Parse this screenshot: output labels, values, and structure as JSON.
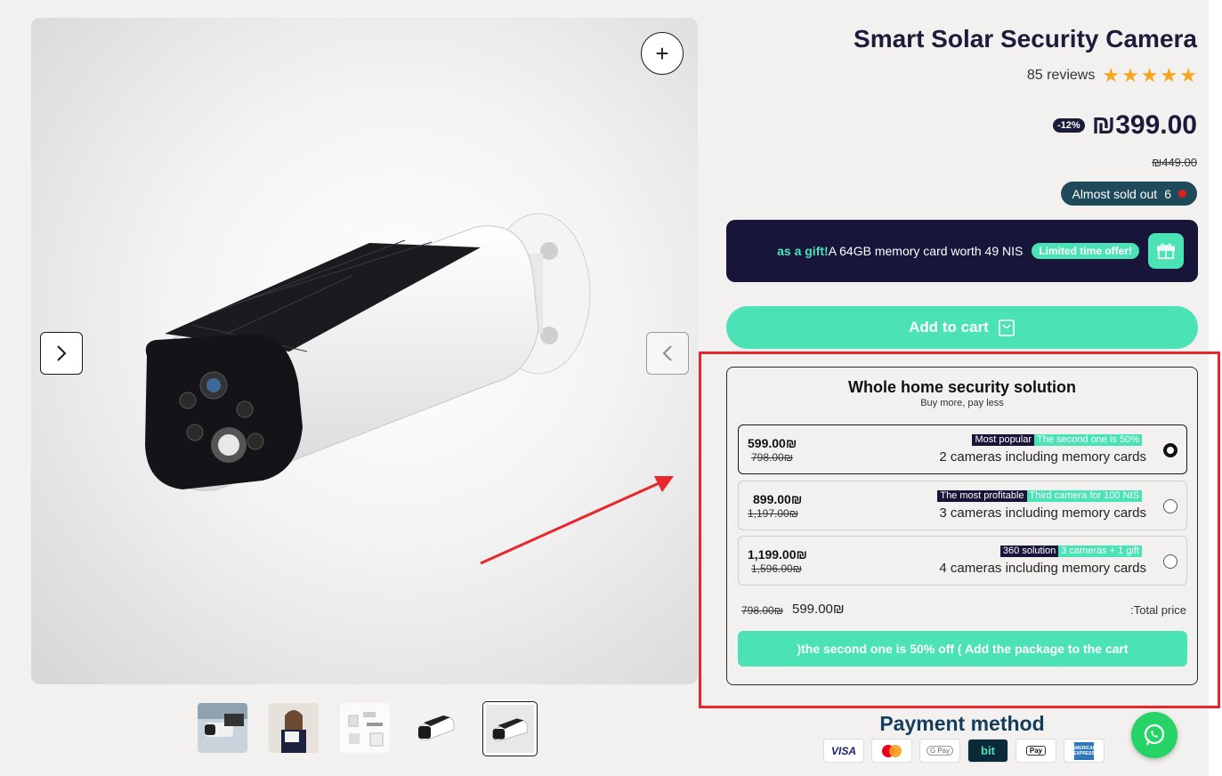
{
  "product": {
    "title": "Smart Solar Security Camera",
    "reviews_text": "85 reviews",
    "rating": 5,
    "discount_badge": "-12%",
    "price": "₪399.00",
    "old_price": "₪449.00",
    "stock_text": "Almost sold out",
    "stock_count": "6"
  },
  "gift_banner": {
    "highlight": "as a gift!",
    "text": "A 64GB memory card worth 49 NIS",
    "pill": "Limited time offer!",
    "icon": "gift-icon"
  },
  "add_to_cart": {
    "label": "Add to cart",
    "icon": "shopping-bag-icon"
  },
  "bundle": {
    "title": "Whole home security solution",
    "subtitle": "Buy more, pay less",
    "options": [
      {
        "price": "599.00₪",
        "old_price": "798.00₪",
        "tag_dark": "Most popular",
        "tag_green": "The second one is 50%",
        "description": "2 cameras including memory cards",
        "selected": true
      },
      {
        "price": "899.00₪",
        "old_price": "1,197.00₪",
        "tag_dark": "The most profitable",
        "tag_green": "Third camera for 100 NIS",
        "description": "3 cameras including memory cards",
        "selected": false
      },
      {
        "price": "1,199.00₪",
        "old_price": "1,596.00₪",
        "tag_dark": "360 solution",
        "tag_green": "3 cameras + 1 gift",
        "description": "4 cameras including memory cards",
        "selected": false
      }
    ],
    "total_old": "798.00₪",
    "total_new": "599.00₪",
    "total_label": ":Total price",
    "cta": ")the second one is 50% off ( Add the package to the cart"
  },
  "payment": {
    "title": "Payment method",
    "methods": [
      "VISA",
      "mastercard",
      "G Pay",
      "bit",
      "Pay",
      "AMERICAN EXPRESS"
    ]
  },
  "gallery": {
    "zoom_icon": "plus-icon",
    "next_icon": "chevron-right-icon",
    "prev_icon": "chevron-left-icon",
    "thumbnail_count": 5,
    "active_thumbnail": 5
  },
  "colors": {
    "accent": "#4be3b6",
    "navy": "#17163a",
    "highlight_frame": "#e8262b",
    "whatsapp": "#25d366"
  }
}
